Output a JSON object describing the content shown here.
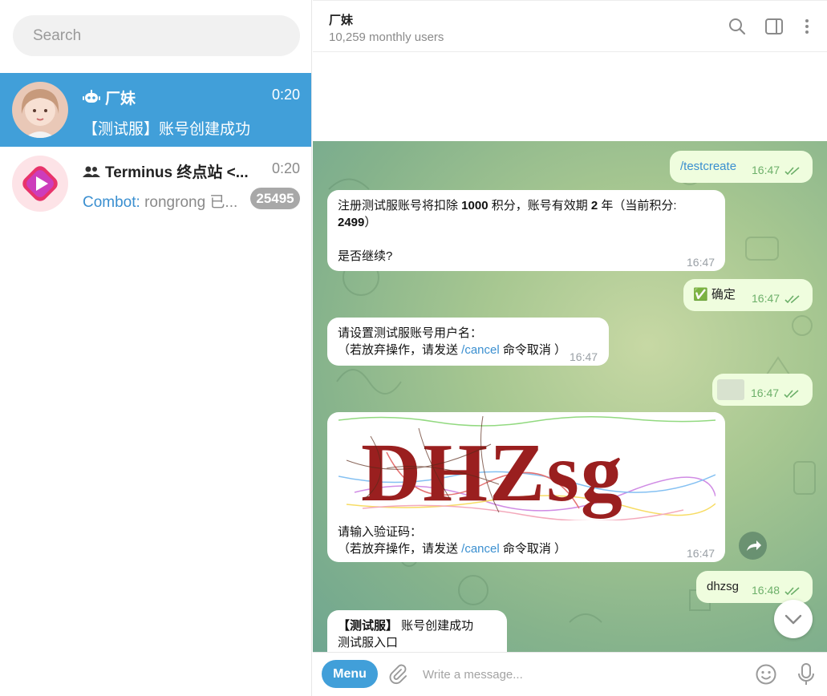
{
  "search": {
    "placeholder": "Search"
  },
  "chats": [
    {
      "title": "厂妹",
      "time": "0:20",
      "preview": "【测试服】账号创建成功",
      "selected": true
    },
    {
      "title": "Terminus 终点站 <...",
      "time": "0:20",
      "preview_sender": "Combot:",
      "preview_text": " rongrong 已...",
      "unread": "25495"
    }
  ],
  "header": {
    "title": "厂妹",
    "subtitle": "10,259 monthly users"
  },
  "messages": [
    {
      "dir": "out",
      "text": "/testcreate",
      "time": "16:47"
    },
    {
      "dir": "in",
      "line1": "注册测试服账号将扣除 ",
      "points": "1000",
      "line1b": " 积分，账号有效期 ",
      "years": "2",
      "line1c": " 年（当前积分: ",
      "balance": "2499",
      "line1d": "）",
      "line2": "是否继续?",
      "time": "16:47"
    },
    {
      "dir": "out",
      "emoji": "✅",
      "text": "确定",
      "time": "16:47"
    },
    {
      "dir": "in",
      "line1": "请设置测试服账号用户名：",
      "line2a": "（若放弃操作，请发送 ",
      "cmd": "/cancel",
      "line2b": " 命令取消 ）",
      "time": "16:47"
    },
    {
      "dir": "out",
      "text": "",
      "time": "16:47"
    },
    {
      "dir": "in",
      "captcha": "DHZsg",
      "line1": "请输入验证码：",
      "line2a": "（若放弃操作，请发送 ",
      "cmd": "/cancel",
      "line2b": " 命令取消 ）",
      "time": "16:47"
    },
    {
      "dir": "out",
      "text": "dhzsg",
      "time": "16:48"
    },
    {
      "dir": "in",
      "bold": "【测试服】",
      "line1": " 账号创建成功",
      "line2": "测试服入口"
    }
  ],
  "composer": {
    "menu_label": "Menu",
    "placeholder": "Write a message..."
  },
  "colors": {
    "accent": "#419fd9",
    "out_bubble": "#effdde",
    "check": "#6db06a"
  }
}
